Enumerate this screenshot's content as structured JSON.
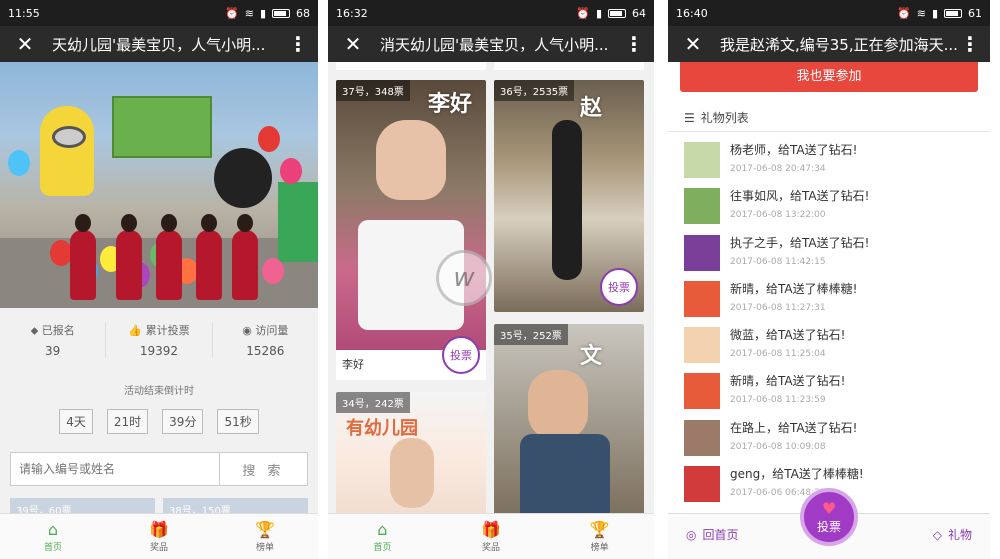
{
  "panel1": {
    "status_time": "11:55",
    "battery": "68",
    "title": "天幼儿园'最美宝贝，人气小明...",
    "stats": [
      {
        "icon": "tag-icon",
        "label": "已报名",
        "value": "39"
      },
      {
        "icon": "thumbs-up-icon",
        "label": "累计投票",
        "value": "19392"
      },
      {
        "icon": "eye-icon",
        "label": "访问量",
        "value": "15286"
      }
    ],
    "countdown_label": "活动结束倒计时",
    "countdown": [
      "4天",
      "21时",
      "39分",
      "51秒"
    ],
    "search_placeholder": "请输入编号或姓名",
    "search_button": "搜 索",
    "peek_cards": [
      "39号，60票",
      "38号，150票"
    ],
    "tabs": [
      {
        "icon": "home-icon",
        "label": "首页"
      },
      {
        "icon": "gift-icon",
        "label": "奖品"
      },
      {
        "icon": "trophy-icon",
        "label": "榜单"
      }
    ]
  },
  "panel2": {
    "status_time": "16:32",
    "battery": "64",
    "title": "消天幼儿园'最美宝贝，人气小明...",
    "cards": [
      {
        "tag": "37号，348票",
        "name": "李好",
        "overlay": "李好"
      },
      {
        "tag": "36号，2535票",
        "name": "",
        "overlay": "赵"
      },
      {
        "tag": "34号，242票",
        "name": "",
        "overlay": ""
      },
      {
        "tag": "35号，252票",
        "name": "",
        "overlay": "文"
      }
    ],
    "vote_label": "投票",
    "watermark_char": "w",
    "tabs": [
      {
        "icon": "home-icon",
        "label": "首页"
      },
      {
        "icon": "gift-icon",
        "label": "奖品"
      },
      {
        "icon": "trophy-icon",
        "label": "榜单"
      }
    ]
  },
  "panel3": {
    "status_time": "16:40",
    "battery": "61",
    "title": "我是赵浠文,编号35,正在参加海天...",
    "join_button": "我也要参加",
    "gift_list_title": "礼物列表",
    "gifts": [
      {
        "text": "杨老师，给TA送了钻石!",
        "time": "2017-06-08 20:47:34",
        "avatar": "#c7d9a8"
      },
      {
        "text": "往事如风，给TA送了钻石!",
        "time": "2017-06-08 13:22:00",
        "avatar": "#7fae5e"
      },
      {
        "text": "执子之手，给TA送了钻石!",
        "time": "2017-06-08 11:42:15",
        "avatar": "#7a3f98"
      },
      {
        "text": "新晴，给TA送了棒棒糖!",
        "time": "2017-06-08 11:27:31",
        "avatar": "#e85b3a"
      },
      {
        "text": "微蓝，给TA送了钻石!",
        "time": "2017-06-08 11:25:04",
        "avatar": "#f3d2b0"
      },
      {
        "text": "新晴，给TA送了钻石!",
        "time": "2017-06-08 11:23:59",
        "avatar": "#e85b3a"
      },
      {
        "text": "在路上，给TA送了钻石!",
        "time": "2017-06-08 10:09:08",
        "avatar": "#9b7a6a"
      },
      {
        "text": "geng，给TA送了棒棒糖!",
        "time": "2017-06-06 06:48:33",
        "avatar": "#d23b3b"
      }
    ],
    "home_label": "回首页",
    "vote_label": "投票",
    "gift_label": "礼物"
  }
}
